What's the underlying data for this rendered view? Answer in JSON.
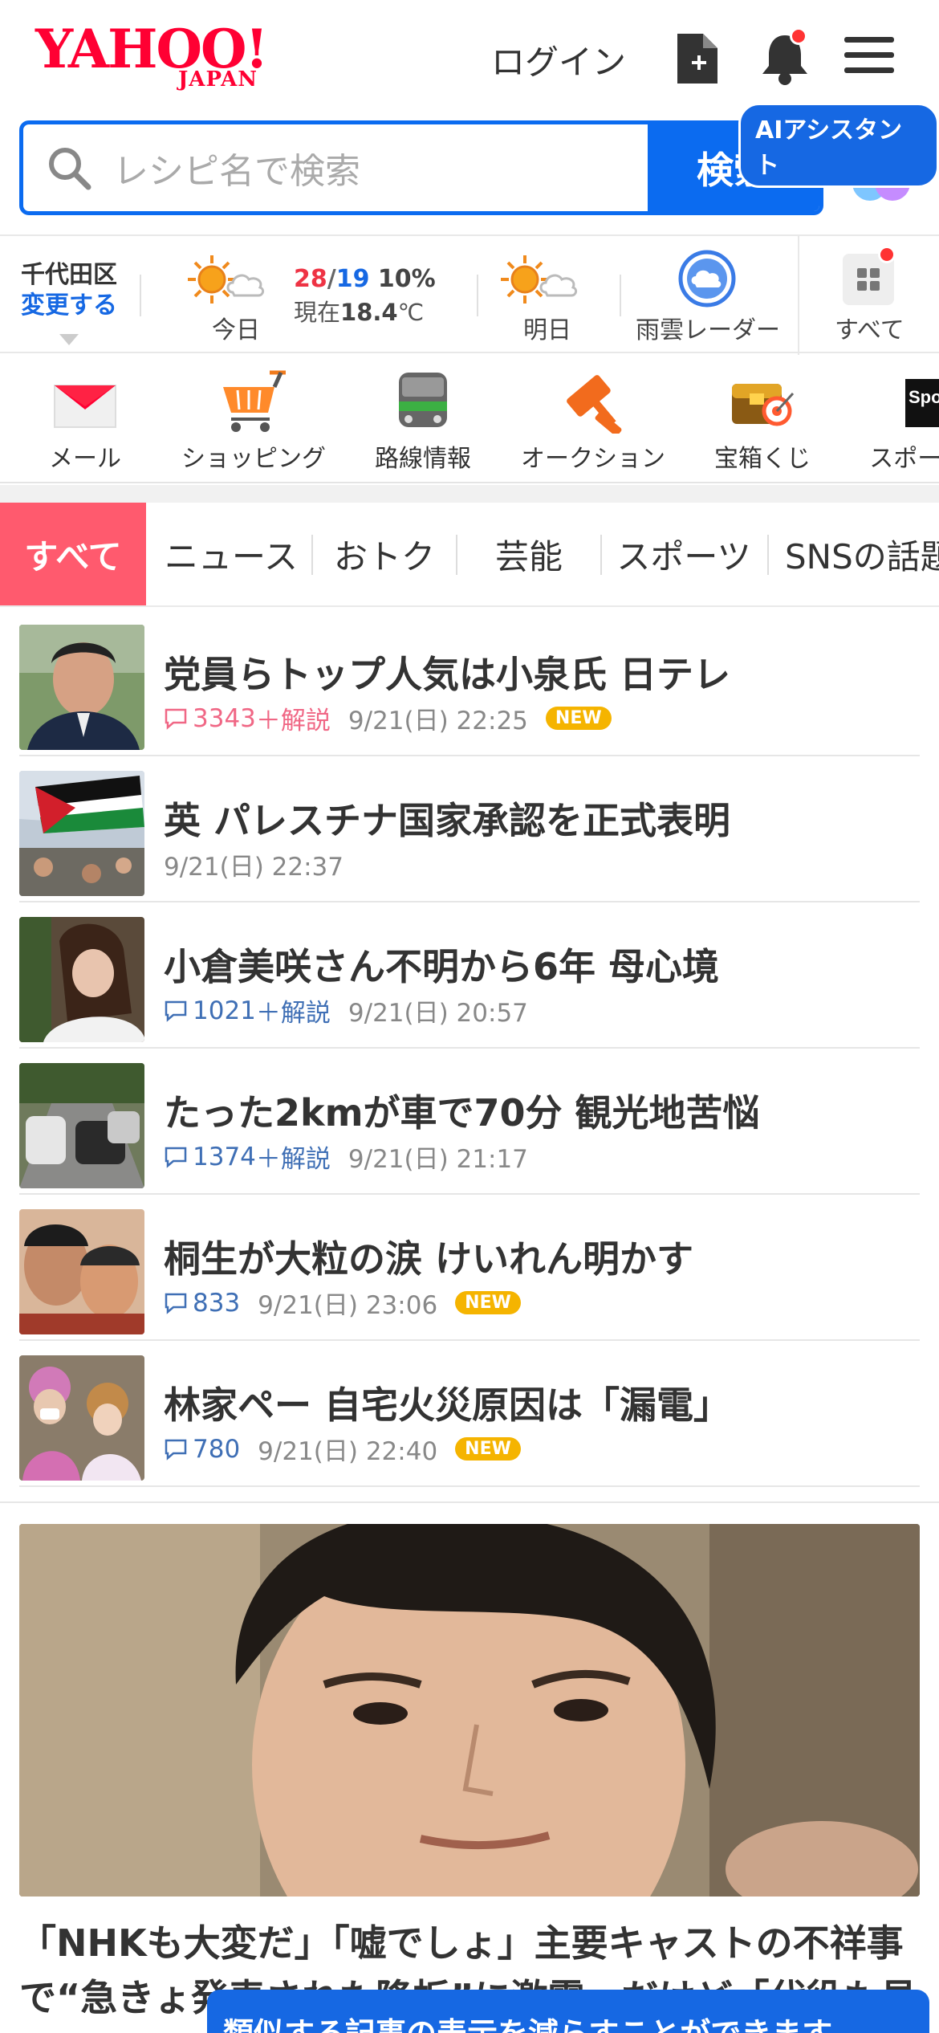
{
  "header": {
    "logo_main": "YAHOO!",
    "logo_sub": "JAPAN",
    "login": "ログイン",
    "icons": [
      "document-add-icon",
      "bell-icon",
      "menu-icon"
    ]
  },
  "search": {
    "placeholder": "レシピ名で検索",
    "button": "検索",
    "ai_badge": "AIアシスタント"
  },
  "weather": {
    "city": "千代田区",
    "change": "変更する",
    "today_label": "今日",
    "high": "28",
    "slash": "/",
    "low": "19",
    "rain": "10%",
    "now_prefix": "現在",
    "now_temp": "18.4",
    "now_unit": "℃",
    "tomorrow_label": "明日",
    "radar_label": "雨雲レーダー",
    "all_label": "すべて"
  },
  "services": [
    {
      "label": "メール",
      "icon": "mail-icon"
    },
    {
      "label": "ショッピング",
      "icon": "cart-icon"
    },
    {
      "label": "路線情報",
      "icon": "train-icon"
    },
    {
      "label": "オークション",
      "icon": "gavel-icon"
    },
    {
      "label": "宝箱くじ",
      "icon": "treasure-icon"
    },
    {
      "label": "スポーツ",
      "icon": "sports-icon"
    }
  ],
  "tabs": [
    "すべて",
    "ニュース",
    "おトク",
    "芸能",
    "スポーツ",
    "SNSの話題"
  ],
  "news": [
    {
      "title": "党員らトップ人気は小泉氏 日テレ",
      "comments": "3343",
      "plus": "＋解説",
      "time": "9/21(日) 22:25",
      "badge": "NEW"
    },
    {
      "title": "英 パレスチナ国家承認を正式表明",
      "time": "9/21(日) 22:37"
    },
    {
      "title": "小倉美咲さん不明から6年 母心境",
      "comments": "1021",
      "plus": "＋解説",
      "time": "9/21(日) 20:57"
    },
    {
      "title": "たった2kmが車で70分 観光地苦悩",
      "comments": "1374",
      "plus": "＋解説",
      "time": "9/21(日) 21:17"
    },
    {
      "title": "桐生が大粒の涙 けいれん明かす",
      "comments": "833",
      "time": "9/21(日) 23:06",
      "badge": "NEW"
    },
    {
      "title": "林家ペー 自宅火災原因は「漏電」",
      "comments": "780",
      "time": "9/21(日) 22:40",
      "badge": "NEW"
    }
  ],
  "feature": {
    "title": "「NHKも大変だ」「嘘でしょ」主要キャストの不祥事で“急きょ発表された降板”に激震…だけど「代役も見たい」"
  },
  "toast": "類似する記事の表示を減らすことができます"
}
